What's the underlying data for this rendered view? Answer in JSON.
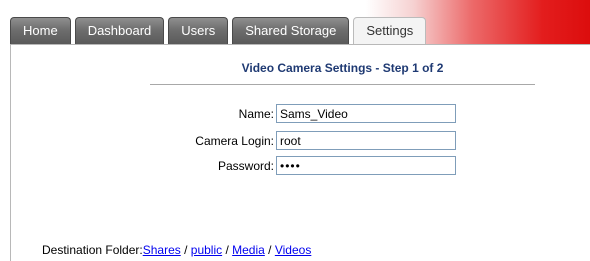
{
  "tabs": [
    {
      "label": "Home",
      "active": false
    },
    {
      "label": "Dashboard",
      "active": false
    },
    {
      "label": "Users",
      "active": false
    },
    {
      "label": "Shared Storage",
      "active": false
    },
    {
      "label": "Settings",
      "active": true
    }
  ],
  "page": {
    "title": "Video Camera Settings - Step 1 of 2"
  },
  "form": {
    "name": {
      "label": "Name:",
      "value": "Sams_Video"
    },
    "login": {
      "label": "Camera Login:",
      "value": "root"
    },
    "password": {
      "label": "Password:",
      "value": "••••"
    }
  },
  "destination": {
    "label": "Destination Folder:",
    "path": [
      "Shares",
      "public",
      "Media",
      "Videos"
    ],
    "separator": " / "
  },
  "colors": {
    "brand_red": "#dc0d0d",
    "title_blue": "#1f3a73",
    "link_blue": "#0000ee",
    "tab_gray": "#6e6e6e"
  }
}
